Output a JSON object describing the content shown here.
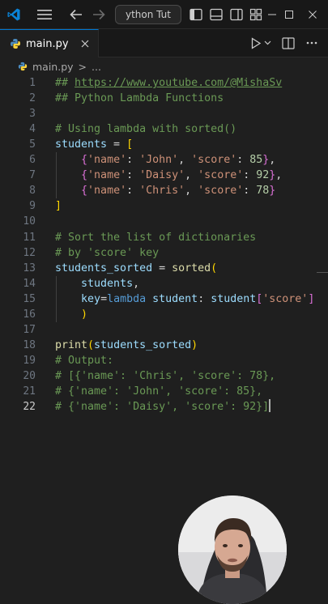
{
  "titlebar": {
    "search_text": "ython Tut",
    "icons": [
      "vscode-logo-icon",
      "menu-icon",
      "back-arrow-icon",
      "forward-arrow-icon",
      "toggle-sidebar-icon",
      "toggle-panel-icon",
      "toggle-secondary-sidebar-icon",
      "customize-layout-icon"
    ]
  },
  "tab": {
    "label": "main.py",
    "icon": "python-file-icon"
  },
  "editor_actions": [
    "run-icon",
    "chevron-down-icon",
    "split-editor-icon",
    "more-icon"
  ],
  "breadcrumb": {
    "file": "main.py",
    "separator": ">",
    "more": "..."
  },
  "colors": {
    "comment": "#6a9955",
    "keyword": "#569cd6",
    "variable": "#9cdcfe",
    "function": "#dcdcaa",
    "string": "#ce9178",
    "number": "#b5cea8",
    "bracket_gold": "#ffd700",
    "bracket_purple": "#da70d6",
    "bracket_blue": "#179fff",
    "plain": "#d4d4d4",
    "accent": "#0078d4"
  },
  "code": {
    "active_line": 22,
    "lines": [
      {
        "n": "1",
        "tokens": [
          [
            "## ",
            "comment"
          ],
          [
            "https://www.youtube.com/@MishaSv",
            "comment-link"
          ]
        ]
      },
      {
        "n": "2",
        "tokens": [
          [
            "## Python Lambda Functions",
            "comment"
          ]
        ]
      },
      {
        "n": "3",
        "tokens": []
      },
      {
        "n": "4",
        "tokens": [
          [
            "# Using lambda with sorted()",
            "comment"
          ]
        ]
      },
      {
        "n": "5",
        "tokens": [
          [
            "students",
            "variable"
          ],
          [
            " = ",
            "plain"
          ],
          [
            "[",
            "bracket_gold"
          ]
        ]
      },
      {
        "n": "6",
        "tokens": [
          [
            "    ",
            "plain"
          ],
          [
            "{",
            "bracket_purple"
          ],
          [
            "'name'",
            "string"
          ],
          [
            ": ",
            "plain"
          ],
          [
            "'John'",
            "string"
          ],
          [
            ", ",
            "plain"
          ],
          [
            "'score'",
            "string"
          ],
          [
            ": ",
            "plain"
          ],
          [
            "85",
            "number"
          ],
          [
            "}",
            "bracket_purple"
          ],
          [
            ",",
            "plain"
          ]
        ]
      },
      {
        "n": "7",
        "tokens": [
          [
            "    ",
            "plain"
          ],
          [
            "{",
            "bracket_purple"
          ],
          [
            "'name'",
            "string"
          ],
          [
            ": ",
            "plain"
          ],
          [
            "'Daisy'",
            "string"
          ],
          [
            ", ",
            "plain"
          ],
          [
            "'score'",
            "string"
          ],
          [
            ": ",
            "plain"
          ],
          [
            "92",
            "number"
          ],
          [
            "}",
            "bracket_purple"
          ],
          [
            ",",
            "plain"
          ]
        ]
      },
      {
        "n": "8",
        "tokens": [
          [
            "    ",
            "plain"
          ],
          [
            "{",
            "bracket_purple"
          ],
          [
            "'name'",
            "string"
          ],
          [
            ": ",
            "plain"
          ],
          [
            "'Chris'",
            "string"
          ],
          [
            ", ",
            "plain"
          ],
          [
            "'score'",
            "string"
          ],
          [
            ": ",
            "plain"
          ],
          [
            "78",
            "number"
          ],
          [
            "}",
            "bracket_purple"
          ]
        ]
      },
      {
        "n": "9",
        "tokens": [
          [
            "]",
            "bracket_gold"
          ]
        ]
      },
      {
        "n": "10",
        "tokens": []
      },
      {
        "n": "11",
        "tokens": [
          [
            "# Sort the list of dictionaries",
            "comment"
          ]
        ]
      },
      {
        "n": "12",
        "tokens": [
          [
            "# by 'score' key",
            "comment"
          ]
        ]
      },
      {
        "n": "13",
        "tokens": [
          [
            "students_sorted",
            "variable"
          ],
          [
            " = ",
            "plain"
          ],
          [
            "sorted",
            "function"
          ],
          [
            "(",
            "bracket_gold"
          ]
        ]
      },
      {
        "n": "14",
        "tokens": [
          [
            "    ",
            "plain"
          ],
          [
            "students",
            "variable"
          ],
          [
            ",",
            "plain"
          ]
        ]
      },
      {
        "n": "15",
        "tokens": [
          [
            "    ",
            "plain"
          ],
          [
            "key",
            "variable"
          ],
          [
            "=",
            "plain"
          ],
          [
            "lambda",
            "keyword"
          ],
          [
            " ",
            "plain"
          ],
          [
            "student",
            "variable"
          ],
          [
            ": ",
            "plain"
          ],
          [
            "student",
            "variable"
          ],
          [
            "[",
            "bracket_purple"
          ],
          [
            "'score'",
            "string"
          ],
          [
            "]",
            "bracket_purple"
          ]
        ]
      },
      {
        "n": "16",
        "tokens": [
          [
            "    ",
            "plain"
          ],
          [
            ")",
            "bracket_gold"
          ]
        ]
      },
      {
        "n": "17",
        "tokens": []
      },
      {
        "n": "18",
        "tokens": [
          [
            "print",
            "function"
          ],
          [
            "(",
            "bracket_gold"
          ],
          [
            "students_sorted",
            "variable"
          ],
          [
            ")",
            "bracket_gold"
          ]
        ]
      },
      {
        "n": "19",
        "tokens": [
          [
            "# Output:",
            "comment"
          ]
        ]
      },
      {
        "n": "20",
        "tokens": [
          [
            "# [{'name': 'Chris', 'score': 78},",
            "comment"
          ]
        ]
      },
      {
        "n": "21",
        "tokens": [
          [
            "# {'name': 'John', 'score': 85},",
            "comment"
          ]
        ]
      },
      {
        "n": "22",
        "tokens": [
          [
            "# {'name': 'Daisy', 'score': 92}]",
            "comment"
          ]
        ]
      }
    ]
  }
}
